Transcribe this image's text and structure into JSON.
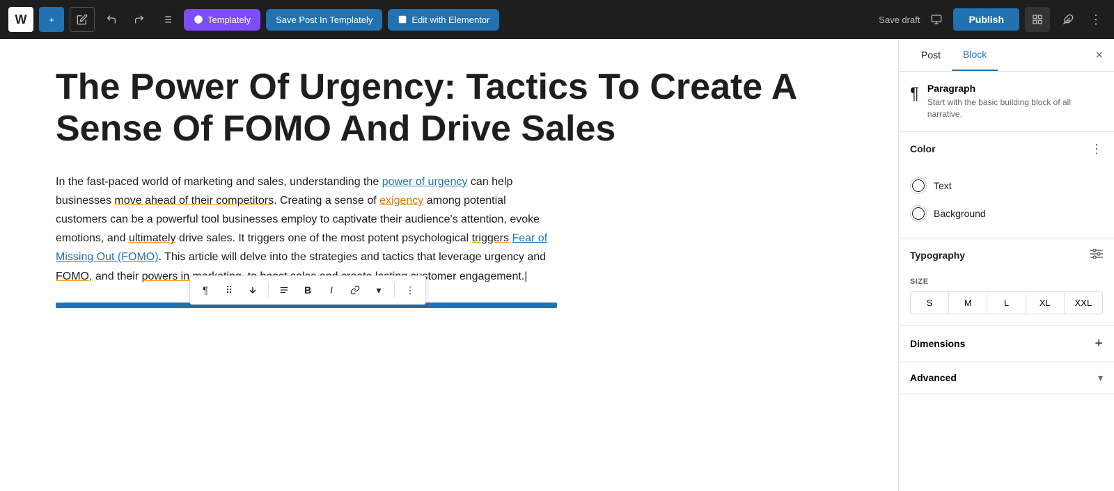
{
  "topbar": {
    "wp_logo": "W",
    "add_label": "+",
    "pencil_label": "✏",
    "undo_label": "↩",
    "redo_label": "↪",
    "list_label": "≡",
    "templately_label": "Templately",
    "save_templately_label": "Save Post In Templately",
    "elementor_label": "Edit with Elementor",
    "save_draft_label": "Save draft",
    "publish_label": "Publish",
    "more_label": "⋮"
  },
  "editor": {
    "title": "The Power Of Urgency: Tactics To Create A Sense Of FOMO And Drive Sales",
    "paragraph": "In the fast-paced world of marketing and sales, understanding the power of urgency can help businesses move ahead of their competitors. Creating a sense of exigency among potential customers can be a powerful tool businesses employ to captivate their audience's attention, evoke emotions, and ultimately drive sales. It triggers one of the most potent psychological triggers Fear of Missing Out (FOMO). This article will delve into the strategies and tactics that leverage urgency and FOMO, and their powers in marketing, to boost sales and create lasting customer engagement."
  },
  "inline_toolbar": {
    "paragraph_icon": "¶",
    "drag_icon": "⠿",
    "arrow_icon": "⌄",
    "align_icon": "≡",
    "bold_label": "B",
    "italic_label": "I",
    "link_icon": "🔗",
    "more_icon": "⋮"
  },
  "right_panel": {
    "post_tab": "Post",
    "block_tab": "Block",
    "close_label": "×",
    "block_name": "Paragraph",
    "block_desc": "Start with the basic building block of all narrative.",
    "color_section_title": "Color",
    "text_label": "Text",
    "background_label": "Background",
    "typography_section_title": "Typography",
    "size_label": "SIZE",
    "size_options": [
      "S",
      "M",
      "L",
      "XL",
      "XXL"
    ],
    "dimensions_title": "Dimensions",
    "advanced_title": "Advanced"
  }
}
